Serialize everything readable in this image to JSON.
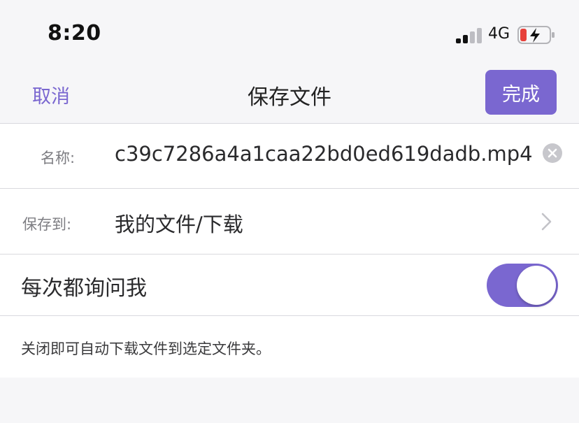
{
  "status": {
    "time": "8:20",
    "network": "4G",
    "battery_level": 0.2
  },
  "nav": {
    "cancel_label": "取消",
    "title": "保存文件",
    "done_label": "完成"
  },
  "form": {
    "name_label": "名称:",
    "name_value": "c39c7286a4a1caa22bd0ed619dadb.mp4",
    "save_label": "保存到:",
    "save_value": "我的文件/下载",
    "ask_label": "每次都询问我",
    "ask_enabled": true
  },
  "footer": {
    "text": "关闭即可自动下载文件到选定文件夹。"
  },
  "colors": {
    "accent": "#7a67d0",
    "battery_low": "#e7403a"
  }
}
